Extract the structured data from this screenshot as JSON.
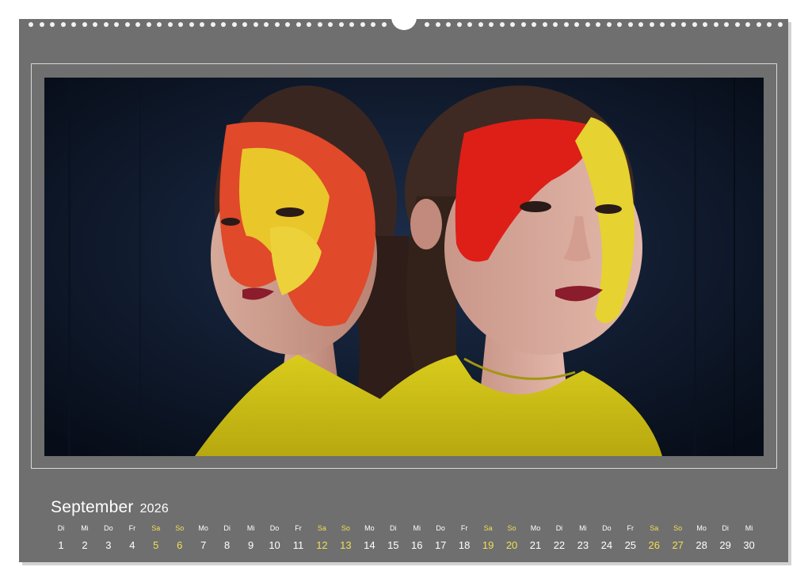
{
  "calendar": {
    "month": "September",
    "year": "2026",
    "colors": {
      "background": "#6f6f6f",
      "weekday_text": "#ffffff",
      "weekend_text": "#f2df52"
    },
    "photo": {
      "icon": "photo-two-women-painted-faces"
    },
    "days": [
      {
        "wd": "Di",
        "n": "1",
        "we": false
      },
      {
        "wd": "Mi",
        "n": "2",
        "we": false
      },
      {
        "wd": "Do",
        "n": "3",
        "we": false
      },
      {
        "wd": "Fr",
        "n": "4",
        "we": false
      },
      {
        "wd": "Sa",
        "n": "5",
        "we": true
      },
      {
        "wd": "So",
        "n": "6",
        "we": true
      },
      {
        "wd": "Mo",
        "n": "7",
        "we": false
      },
      {
        "wd": "Di",
        "n": "8",
        "we": false
      },
      {
        "wd": "Mi",
        "n": "9",
        "we": false
      },
      {
        "wd": "Do",
        "n": "10",
        "we": false
      },
      {
        "wd": "Fr",
        "n": "11",
        "we": false
      },
      {
        "wd": "Sa",
        "n": "12",
        "we": true
      },
      {
        "wd": "So",
        "n": "13",
        "we": true
      },
      {
        "wd": "Mo",
        "n": "14",
        "we": false
      },
      {
        "wd": "Di",
        "n": "15",
        "we": false
      },
      {
        "wd": "Mi",
        "n": "16",
        "we": false
      },
      {
        "wd": "Do",
        "n": "17",
        "we": false
      },
      {
        "wd": "Fr",
        "n": "18",
        "we": false
      },
      {
        "wd": "Sa",
        "n": "19",
        "we": true
      },
      {
        "wd": "So",
        "n": "20",
        "we": true
      },
      {
        "wd": "Mo",
        "n": "21",
        "we": false
      },
      {
        "wd": "Di",
        "n": "22",
        "we": false
      },
      {
        "wd": "Mi",
        "n": "23",
        "we": false
      },
      {
        "wd": "Do",
        "n": "24",
        "we": false
      },
      {
        "wd": "Fr",
        "n": "25",
        "we": false
      },
      {
        "wd": "Sa",
        "n": "26",
        "we": true
      },
      {
        "wd": "So",
        "n": "27",
        "we": true
      },
      {
        "wd": "Mo",
        "n": "28",
        "we": false
      },
      {
        "wd": "Di",
        "n": "29",
        "we": false
      },
      {
        "wd": "Mi",
        "n": "30",
        "we": false
      }
    ]
  }
}
